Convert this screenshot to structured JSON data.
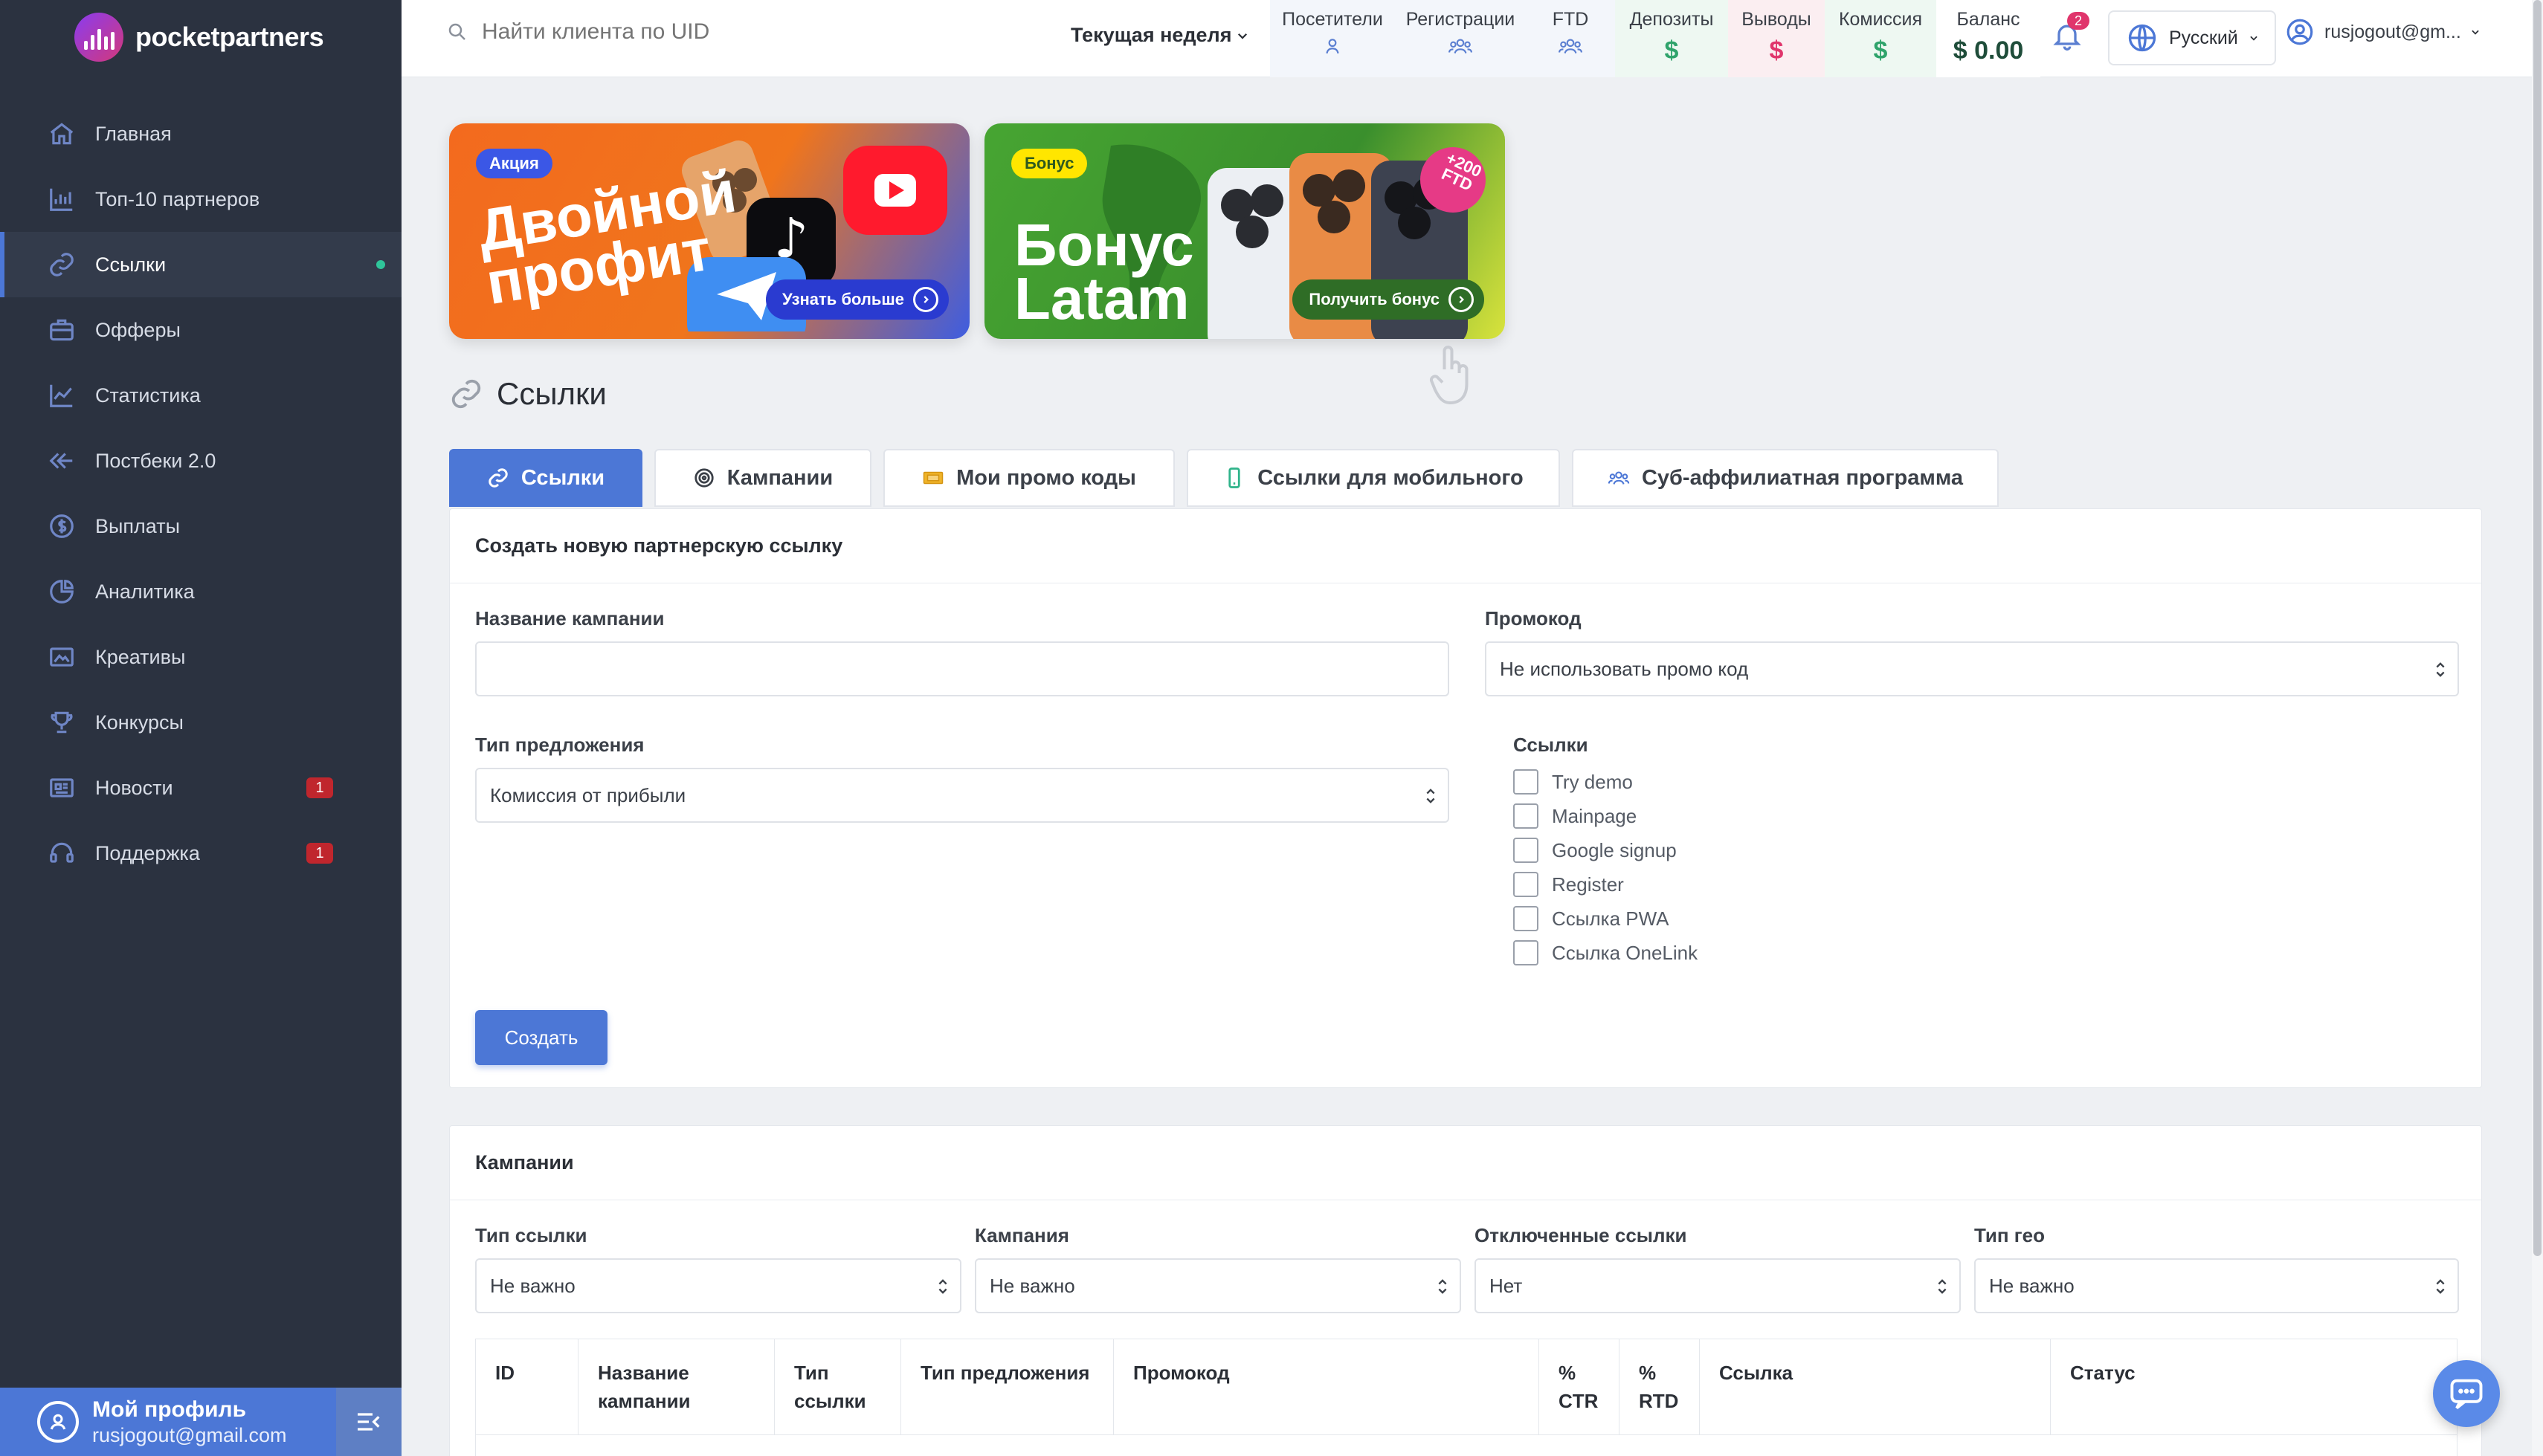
{
  "brand": {
    "name": "pocketpartners"
  },
  "sidebar": {
    "items": [
      {
        "label": "Главная",
        "icon": "home-icon"
      },
      {
        "label": "Топ-10 партнеров",
        "icon": "bar-chart-icon"
      },
      {
        "label": "Ссылки",
        "icon": "link-icon",
        "active": true
      },
      {
        "label": "Офферы",
        "icon": "briefcase-icon"
      },
      {
        "label": "Статистика",
        "icon": "line-chart-icon"
      },
      {
        "label": "Постбеки 2.0",
        "icon": "postback-icon"
      },
      {
        "label": "Выплаты",
        "icon": "dollar-circle-icon"
      },
      {
        "label": "Аналитика",
        "icon": "pie-chart-icon"
      },
      {
        "label": "Креативы",
        "icon": "image-icon"
      },
      {
        "label": "Конкурсы",
        "icon": "trophy-icon"
      },
      {
        "label": "Новости",
        "icon": "news-icon",
        "badge": "1"
      },
      {
        "label": "Поддержка",
        "icon": "headset-icon",
        "badge": "1"
      }
    ],
    "profile": {
      "name": "Мой профиль",
      "email": "rusjogout@gmail.com"
    }
  },
  "topbar": {
    "search_placeholder": "Найти клиента по UID",
    "period": "Текущая неделя",
    "stats": [
      {
        "label": "Посетители",
        "icon": "user-icon"
      },
      {
        "label": "Регистрации",
        "icon": "users-icon"
      },
      {
        "label": "FTD",
        "icon": "users-icon"
      },
      {
        "label": "Депозиты",
        "value": "$",
        "color": "#2fa36b"
      },
      {
        "label": "Выводы",
        "value": "$",
        "color": "#e0356c"
      },
      {
        "label": "Комиссия",
        "value": "$",
        "color": "#2fa36b"
      },
      {
        "label": "Баланс",
        "value": "$ 0.00",
        "color": "#1f4d3a"
      }
    ],
    "notifications": "2",
    "language": "Русский",
    "user": "rusjogout@gm..."
  },
  "banners": [
    {
      "tag": "Акция",
      "title": "Двойной профит",
      "button": "Узнать больше"
    },
    {
      "tag": "Бонус",
      "title": "Бонус Latam",
      "button": "Получить бонус",
      "sticker": "+200 FTD"
    }
  ],
  "page": {
    "title": "Ссылки"
  },
  "tabs": [
    {
      "label": "Ссылки",
      "icon": "link-icon",
      "active": true
    },
    {
      "label": "Кампании",
      "icon": "target-icon"
    },
    {
      "label": "Мои промо коды",
      "icon": "ticket-icon"
    },
    {
      "label": "Ссылки для мобильного",
      "icon": "mobile-icon"
    },
    {
      "label": "Суб-аффилиатная программа",
      "icon": "users-icon"
    }
  ],
  "create_form": {
    "header": "Создать новую партнерскую ссылку",
    "campaign_name_label": "Название кампании",
    "campaign_name_value": "",
    "promo_label": "Промокод",
    "promo_value": "Не использовать промо код",
    "offer_type_label": "Тип предложения",
    "offer_type_value": "Комиссия от прибыли",
    "links_label": "Ссылки",
    "links": [
      "Try demo",
      "Mainpage",
      "Google signup",
      "Register",
      "Ссылка PWA",
      "Ссылка OneLink"
    ],
    "create_button": "Создать"
  },
  "campaigns": {
    "header": "Кампании",
    "filters": [
      {
        "label": "Тип ссылки",
        "value": "Не важно"
      },
      {
        "label": "Кампания",
        "value": "Не важно"
      },
      {
        "label": "Отключенные ссылки",
        "value": "Нет"
      },
      {
        "label": "Тип гео",
        "value": "Не важно"
      }
    ],
    "columns": [
      "ID",
      "Название кампании",
      "Тип ссылки",
      "Тип предложения",
      "Промокод",
      "% CTR",
      "% RTD",
      "Ссылка",
      "Статус"
    ]
  }
}
